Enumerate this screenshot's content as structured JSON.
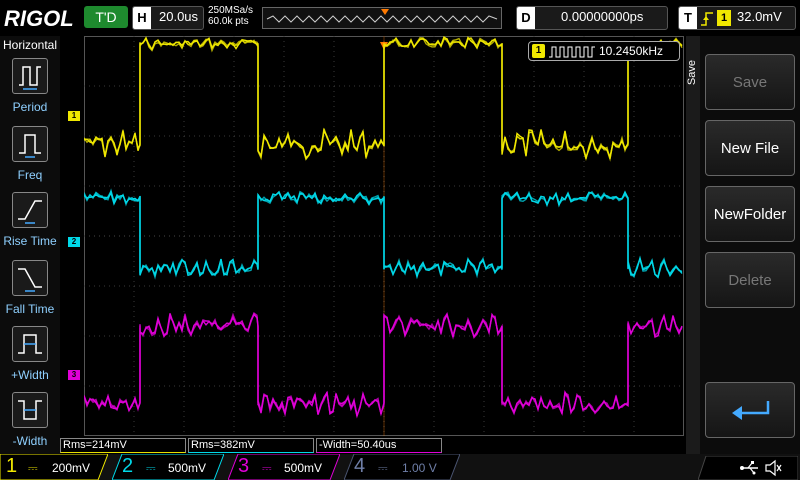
{
  "header": {
    "logo": "RIGOL",
    "trigger_status": "T'D",
    "horizontal": {
      "label": "H",
      "timebase": "20.0us"
    },
    "sample_rate": "250MSa/s",
    "memory_depth": "60.0k pts",
    "delay": {
      "label": "D",
      "value": "0.00000000ps"
    },
    "trigger": {
      "label": "T",
      "source": "1",
      "level": "32.0mV"
    }
  },
  "sidebar": {
    "title": "Horizontal",
    "items": [
      {
        "label": "Period"
      },
      {
        "label": "Freq"
      },
      {
        "label": "Rise Time"
      },
      {
        "label": "Fall Time"
      },
      {
        "label": "+Width"
      },
      {
        "label": "-Width"
      }
    ]
  },
  "freq_readout": {
    "channel": "1",
    "value": "10.2450kHz"
  },
  "channel_markers": [
    "1",
    "2",
    "3"
  ],
  "softkeys": {
    "title": "Save",
    "items": [
      {
        "label": "Save",
        "enabled": false
      },
      {
        "label": "New File",
        "enabled": true
      },
      {
        "label": "NewFolder",
        "enabled": true
      },
      {
        "label": "Delete",
        "enabled": false
      }
    ]
  },
  "results": [
    {
      "text": "Rms=214mV",
      "color": "#e8e000"
    },
    {
      "text": "Rms=382mV",
      "color": "#00d8e8"
    },
    {
      "text": "-Width=50.40us",
      "color": "#e000d8"
    }
  ],
  "channels": [
    {
      "num": "1",
      "scale": "200mV",
      "color": "#f0e800",
      "enabled": true
    },
    {
      "num": "2",
      "scale": "500mV",
      "color": "#00d8e8",
      "enabled": true
    },
    {
      "num": "3",
      "scale": "500mV",
      "color": "#e000d8",
      "enabled": true
    },
    {
      "num": "4",
      "scale": "1.00 V",
      "color": "#6f7fa8",
      "enabled": false
    }
  ],
  "colors": {
    "ch1": "#f0e800",
    "ch2": "#00d8e8",
    "ch3": "#e000d8",
    "grid": "#3a3a3a",
    "accent": "#1e8a2e"
  }
}
